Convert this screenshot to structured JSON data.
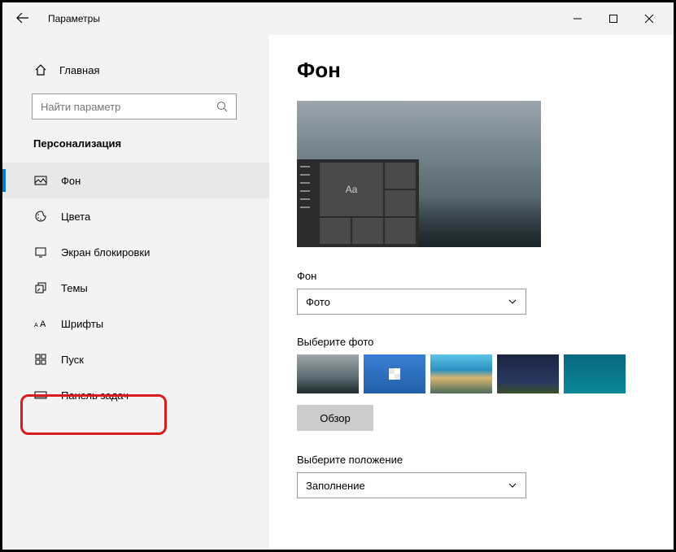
{
  "window": {
    "title": "Параметры"
  },
  "sidebar": {
    "home": "Главная",
    "search_placeholder": "Найти параметр",
    "category": "Персонализация",
    "items": [
      {
        "label": "Фон",
        "icon": "image-icon"
      },
      {
        "label": "Цвета",
        "icon": "palette-icon"
      },
      {
        "label": "Экран блокировки",
        "icon": "lockscreen-icon"
      },
      {
        "label": "Темы",
        "icon": "themes-icon"
      },
      {
        "label": "Шрифты",
        "icon": "fonts-icon"
      },
      {
        "label": "Пуск",
        "icon": "start-icon"
      },
      {
        "label": "Панель задач",
        "icon": "taskbar-icon"
      }
    ]
  },
  "main": {
    "title": "Фон",
    "preview_sample": "Aa",
    "background_label": "Фон",
    "background_value": "Фото",
    "choose_photo_label": "Выберите фото",
    "browse_label": "Обзор",
    "position_label": "Выберите положение",
    "position_value": "Заполнение"
  }
}
